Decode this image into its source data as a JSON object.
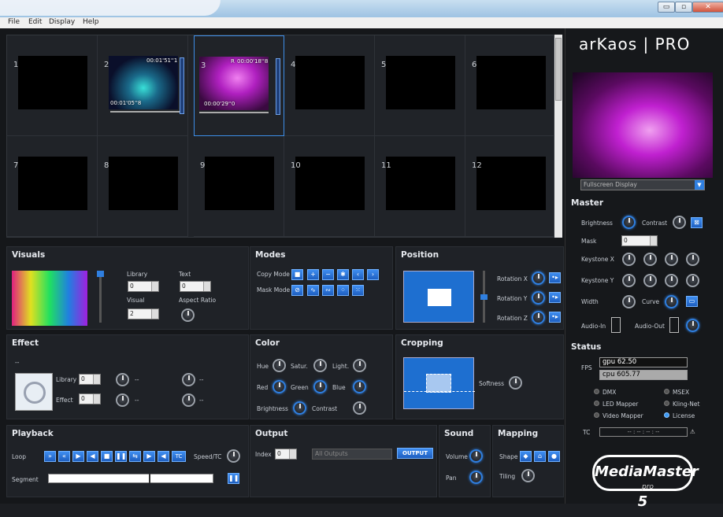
{
  "menu": {
    "items": [
      "File",
      "Edit",
      "Display",
      "Help"
    ]
  },
  "window": {
    "minimize": "▭",
    "maximize": "▫",
    "close": "✕"
  },
  "grid": {
    "cells": [
      {
        "n": "1"
      },
      {
        "n": "2",
        "tc_top": "00:01'51''1",
        "tc_bot": "00:01'05''8"
      },
      {
        "n": "3",
        "tc_top": "00:00'18''8",
        "tc_bot": "00:00'29''0",
        "r": "R"
      },
      {
        "n": "4"
      },
      {
        "n": "5"
      },
      {
        "n": "6"
      },
      {
        "n": "7"
      },
      {
        "n": "8"
      },
      {
        "n": "9"
      },
      {
        "n": "10"
      },
      {
        "n": "11"
      },
      {
        "n": "12"
      }
    ]
  },
  "visuals": {
    "title": "Visuals",
    "library_label": "Library",
    "library_value": "0",
    "text_label": "Text",
    "text_value": "0",
    "visual_label": "Visual",
    "visual_value": "2",
    "aspect_label": "Aspect Ratio"
  },
  "modes": {
    "title": "Modes",
    "copy_label": "Copy Mode",
    "mask_label": "Mask Mode"
  },
  "position": {
    "title": "Position",
    "rx": "Rotation X",
    "ry": "Rotation Y",
    "rz": "Rotation Z"
  },
  "effect": {
    "title": "Effect",
    "dash": "--",
    "library_label": "Library",
    "library_value": "0",
    "effect_label": "Effect",
    "effect_value": "0",
    "d1": "--",
    "d2": "--",
    "d3": "--",
    "d4": "--"
  },
  "color": {
    "title": "Color",
    "hue": "Hue",
    "satur": "Satur.",
    "light": "Light.",
    "red": "Red",
    "green": "Green",
    "blue": "Blue",
    "brightness": "Brightness",
    "contrast": "Contrast"
  },
  "cropping": {
    "title": "Cropping",
    "softness": "Softness"
  },
  "playback": {
    "title": "Playback",
    "loop": "Loop",
    "speed": "Speed/TC",
    "segment": "Segment",
    "tc_btn": "TC"
  },
  "output": {
    "title": "Output",
    "index_label": "Index",
    "index_value": "0",
    "all_outputs": "All Outputs",
    "output_btn": "OUTPUT"
  },
  "sound": {
    "title": "Sound",
    "volume": "Volume",
    "pan": "Pan"
  },
  "mapping": {
    "title": "Mapping",
    "shape": "Shape",
    "tiling": "Tiling"
  },
  "side": {
    "logo": "arKaos | PRO",
    "display_select": "Fullscreen Display",
    "master_title": "Master",
    "brightness": "Brightness",
    "contrast": "Contrast",
    "mask": "Mask",
    "mask_value": "0",
    "keystone_x": "Keystone X",
    "keystone_y": "Keystone Y",
    "width": "Width",
    "curve": "Curve",
    "audio_in": "Audio-In",
    "audio_out": "Audio-Out",
    "status_title": "Status",
    "fps_label": "FPS",
    "gpu": "gpu 62.50",
    "cpu": "cpu 605.77",
    "dmx": "DMX",
    "msex": "MSEX",
    "led": "LED Mapper",
    "kling": "Kling-Net",
    "video_mapper": "Video Mapper",
    "license": "License",
    "tc_label": "TC",
    "tc_value": "-- : -- : -- : --",
    "mm_logo": "MediaMaster 5",
    "mm_pro": "pro"
  },
  "colors": {
    "accent": "#2f7fe0",
    "magenta": "#c020d0"
  }
}
